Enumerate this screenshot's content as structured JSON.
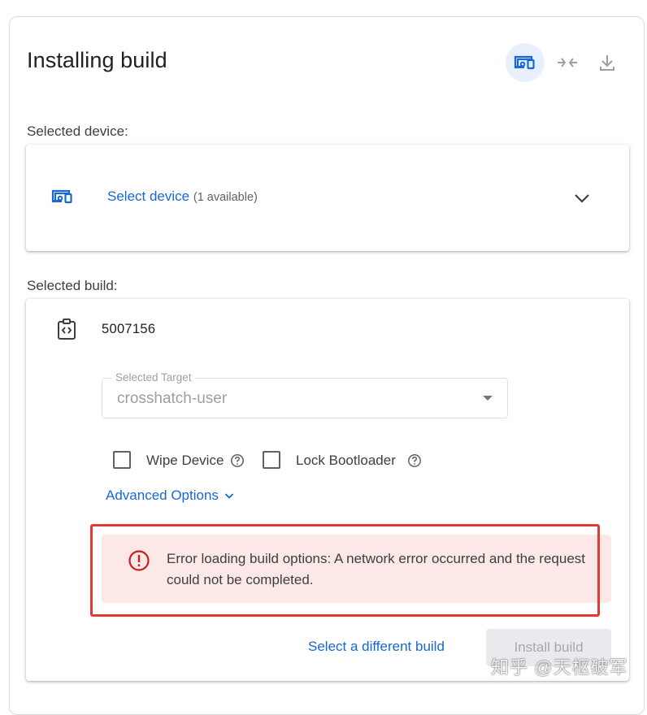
{
  "header": {
    "title": "Installing build",
    "icons": [
      "device-connect-icon",
      "compress-arrows-icon",
      "download-icon"
    ]
  },
  "device_section": {
    "label": "Selected device:",
    "select_text": "Select device",
    "available": "(1 available)"
  },
  "build_section": {
    "label": "Selected build:",
    "build_id": "5007156",
    "target": {
      "label": "Selected Target",
      "value": "crosshatch-user"
    },
    "options": [
      {
        "label": "Wipe Device",
        "checked": false
      },
      {
        "label": "Lock Bootloader",
        "checked": false
      }
    ],
    "advanced_label": "Advanced Options",
    "error": "Error loading build options: A network error occurred and the request could not be completed.",
    "select_different": "Select a different build",
    "install_label": "Install build"
  },
  "watermark": "知乎 @天枢破军",
  "colors": {
    "accent": "#1967d2",
    "error_bg": "#fce8e6",
    "error_icon": "#c5221f",
    "highlight": "#e53935",
    "disabled_bg": "#e8eaed"
  }
}
